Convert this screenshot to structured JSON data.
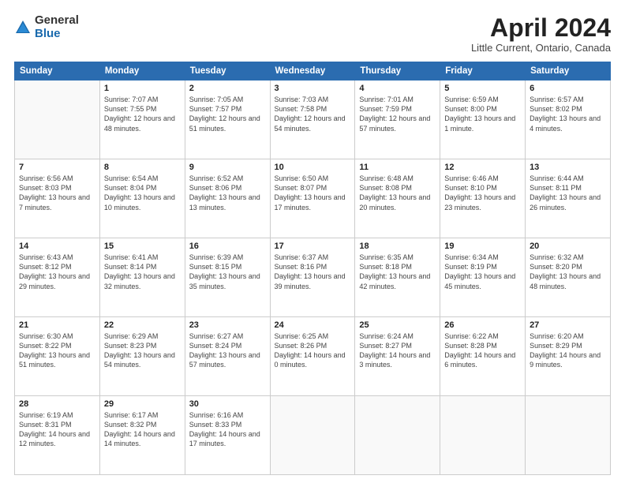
{
  "logo": {
    "general": "General",
    "blue": "Blue"
  },
  "title": "April 2024",
  "subtitle": "Little Current, Ontario, Canada",
  "days_of_week": [
    "Sunday",
    "Monday",
    "Tuesday",
    "Wednesday",
    "Thursday",
    "Friday",
    "Saturday"
  ],
  "weeks": [
    [
      {
        "num": "",
        "sunrise": "",
        "sunset": "",
        "daylight": "",
        "empty": true
      },
      {
        "num": "1",
        "sunrise": "Sunrise: 7:07 AM",
        "sunset": "Sunset: 7:55 PM",
        "daylight": "Daylight: 12 hours and 48 minutes."
      },
      {
        "num": "2",
        "sunrise": "Sunrise: 7:05 AM",
        "sunset": "Sunset: 7:57 PM",
        "daylight": "Daylight: 12 hours and 51 minutes."
      },
      {
        "num": "3",
        "sunrise": "Sunrise: 7:03 AM",
        "sunset": "Sunset: 7:58 PM",
        "daylight": "Daylight: 12 hours and 54 minutes."
      },
      {
        "num": "4",
        "sunrise": "Sunrise: 7:01 AM",
        "sunset": "Sunset: 7:59 PM",
        "daylight": "Daylight: 12 hours and 57 minutes."
      },
      {
        "num": "5",
        "sunrise": "Sunrise: 6:59 AM",
        "sunset": "Sunset: 8:00 PM",
        "daylight": "Daylight: 13 hours and 1 minute."
      },
      {
        "num": "6",
        "sunrise": "Sunrise: 6:57 AM",
        "sunset": "Sunset: 8:02 PM",
        "daylight": "Daylight: 13 hours and 4 minutes."
      }
    ],
    [
      {
        "num": "7",
        "sunrise": "Sunrise: 6:56 AM",
        "sunset": "Sunset: 8:03 PM",
        "daylight": "Daylight: 13 hours and 7 minutes."
      },
      {
        "num": "8",
        "sunrise": "Sunrise: 6:54 AM",
        "sunset": "Sunset: 8:04 PM",
        "daylight": "Daylight: 13 hours and 10 minutes."
      },
      {
        "num": "9",
        "sunrise": "Sunrise: 6:52 AM",
        "sunset": "Sunset: 8:06 PM",
        "daylight": "Daylight: 13 hours and 13 minutes."
      },
      {
        "num": "10",
        "sunrise": "Sunrise: 6:50 AM",
        "sunset": "Sunset: 8:07 PM",
        "daylight": "Daylight: 13 hours and 17 minutes."
      },
      {
        "num": "11",
        "sunrise": "Sunrise: 6:48 AM",
        "sunset": "Sunset: 8:08 PM",
        "daylight": "Daylight: 13 hours and 20 minutes."
      },
      {
        "num": "12",
        "sunrise": "Sunrise: 6:46 AM",
        "sunset": "Sunset: 8:10 PM",
        "daylight": "Daylight: 13 hours and 23 minutes."
      },
      {
        "num": "13",
        "sunrise": "Sunrise: 6:44 AM",
        "sunset": "Sunset: 8:11 PM",
        "daylight": "Daylight: 13 hours and 26 minutes."
      }
    ],
    [
      {
        "num": "14",
        "sunrise": "Sunrise: 6:43 AM",
        "sunset": "Sunset: 8:12 PM",
        "daylight": "Daylight: 13 hours and 29 minutes."
      },
      {
        "num": "15",
        "sunrise": "Sunrise: 6:41 AM",
        "sunset": "Sunset: 8:14 PM",
        "daylight": "Daylight: 13 hours and 32 minutes."
      },
      {
        "num": "16",
        "sunrise": "Sunrise: 6:39 AM",
        "sunset": "Sunset: 8:15 PM",
        "daylight": "Daylight: 13 hours and 35 minutes."
      },
      {
        "num": "17",
        "sunrise": "Sunrise: 6:37 AM",
        "sunset": "Sunset: 8:16 PM",
        "daylight": "Daylight: 13 hours and 39 minutes."
      },
      {
        "num": "18",
        "sunrise": "Sunrise: 6:35 AM",
        "sunset": "Sunset: 8:18 PM",
        "daylight": "Daylight: 13 hours and 42 minutes."
      },
      {
        "num": "19",
        "sunrise": "Sunrise: 6:34 AM",
        "sunset": "Sunset: 8:19 PM",
        "daylight": "Daylight: 13 hours and 45 minutes."
      },
      {
        "num": "20",
        "sunrise": "Sunrise: 6:32 AM",
        "sunset": "Sunset: 8:20 PM",
        "daylight": "Daylight: 13 hours and 48 minutes."
      }
    ],
    [
      {
        "num": "21",
        "sunrise": "Sunrise: 6:30 AM",
        "sunset": "Sunset: 8:22 PM",
        "daylight": "Daylight: 13 hours and 51 minutes."
      },
      {
        "num": "22",
        "sunrise": "Sunrise: 6:29 AM",
        "sunset": "Sunset: 8:23 PM",
        "daylight": "Daylight: 13 hours and 54 minutes."
      },
      {
        "num": "23",
        "sunrise": "Sunrise: 6:27 AM",
        "sunset": "Sunset: 8:24 PM",
        "daylight": "Daylight: 13 hours and 57 minutes."
      },
      {
        "num": "24",
        "sunrise": "Sunrise: 6:25 AM",
        "sunset": "Sunset: 8:26 PM",
        "daylight": "Daylight: 14 hours and 0 minutes."
      },
      {
        "num": "25",
        "sunrise": "Sunrise: 6:24 AM",
        "sunset": "Sunset: 8:27 PM",
        "daylight": "Daylight: 14 hours and 3 minutes."
      },
      {
        "num": "26",
        "sunrise": "Sunrise: 6:22 AM",
        "sunset": "Sunset: 8:28 PM",
        "daylight": "Daylight: 14 hours and 6 minutes."
      },
      {
        "num": "27",
        "sunrise": "Sunrise: 6:20 AM",
        "sunset": "Sunset: 8:29 PM",
        "daylight": "Daylight: 14 hours and 9 minutes."
      }
    ],
    [
      {
        "num": "28",
        "sunrise": "Sunrise: 6:19 AM",
        "sunset": "Sunset: 8:31 PM",
        "daylight": "Daylight: 14 hours and 12 minutes."
      },
      {
        "num": "29",
        "sunrise": "Sunrise: 6:17 AM",
        "sunset": "Sunset: 8:32 PM",
        "daylight": "Daylight: 14 hours and 14 minutes."
      },
      {
        "num": "30",
        "sunrise": "Sunrise: 6:16 AM",
        "sunset": "Sunset: 8:33 PM",
        "daylight": "Daylight: 14 hours and 17 minutes."
      },
      {
        "num": "",
        "sunrise": "",
        "sunset": "",
        "daylight": "",
        "empty": true
      },
      {
        "num": "",
        "sunrise": "",
        "sunset": "",
        "daylight": "",
        "empty": true
      },
      {
        "num": "",
        "sunrise": "",
        "sunset": "",
        "daylight": "",
        "empty": true
      },
      {
        "num": "",
        "sunrise": "",
        "sunset": "",
        "daylight": "",
        "empty": true
      }
    ]
  ]
}
